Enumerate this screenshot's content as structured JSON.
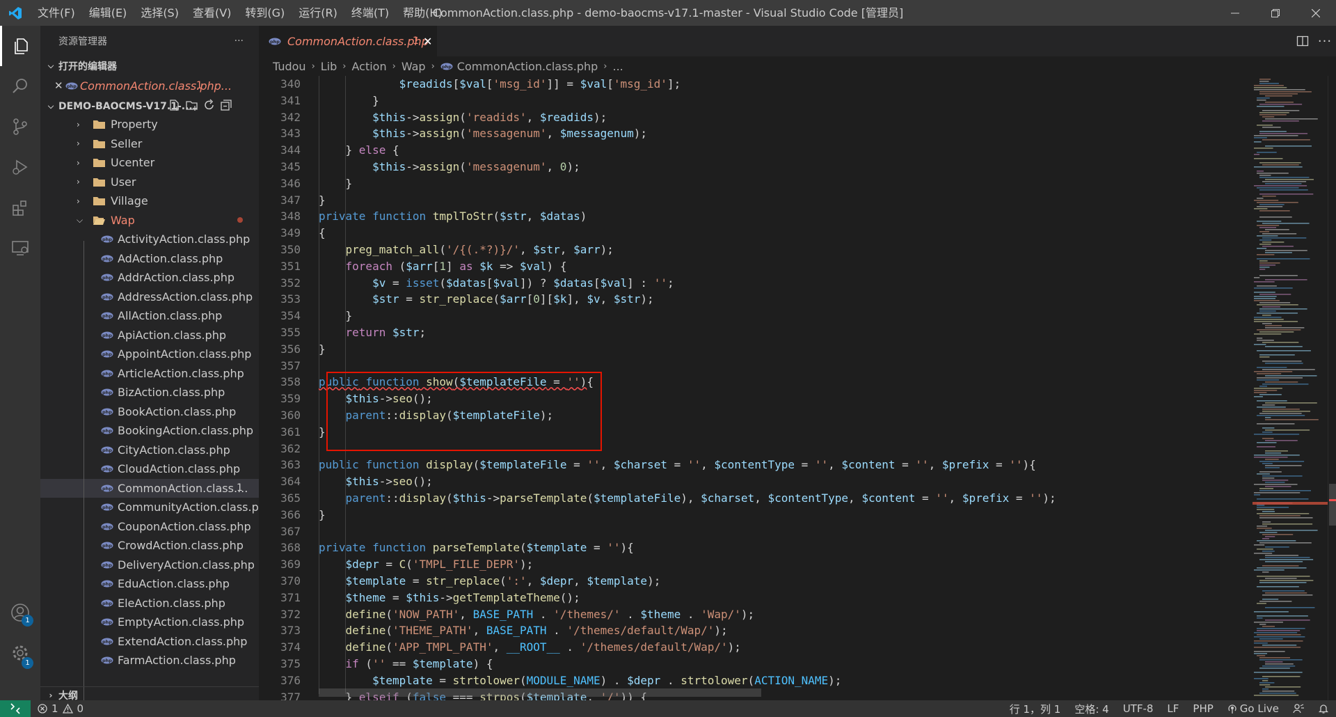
{
  "window": {
    "title": "CommonAction.class.php - demo-baocms-v17.1-master - Visual Studio Code [管理员]",
    "menu": [
      "文件(F)",
      "编辑(E)",
      "选择(S)",
      "查看(V)",
      "转到(G)",
      "运行(R)",
      "终端(T)",
      "帮助(H)"
    ]
  },
  "activity_bar": {
    "accounts_badge": "1",
    "settings_badge": "1"
  },
  "sidebar": {
    "title": "资源管理器",
    "more": "···",
    "open_editors_label": "打开的编辑器",
    "open_editor_file": "CommonAction.class.php...",
    "open_editor_problems": "1",
    "workspace_label": "DEMO-BAOCMS-V17.1-...",
    "folders": [
      "Property",
      "Seller",
      "Ucenter",
      "User",
      "Village"
    ],
    "open_folder": "Wap",
    "files": [
      "ActivityAction.class.php",
      "AdAction.class.php",
      "AddrAction.class.php",
      "AddressAction.class.php",
      "AllAction.class.php",
      "ApiAction.class.php",
      "AppointAction.class.php",
      "ArticleAction.class.php",
      "BizAction.class.php",
      "BookAction.class.php",
      "BookingAction.class.php",
      "CityAction.class.php",
      "CloudAction.class.php",
      "CommonAction.class....",
      "CommunityAction.class.php",
      "CouponAction.class.php",
      "CrowdAction.class.php",
      "DeliveryAction.class.php",
      "EduAction.class.php",
      "EleAction.class.php",
      "EmptyAction.class.php",
      "ExtendAction.class.php",
      "FarmAction.class.php"
    ],
    "selected_file_problems": "1",
    "outline_label": "大纲"
  },
  "tab": {
    "label": "CommonAction.class.php",
    "problems": "1",
    "close": "✕"
  },
  "breadcrumb": [
    "Tudou",
    "Lib",
    "Action",
    "Wap",
    "CommonAction.class.php",
    "..."
  ],
  "editor": {
    "line_numbers": [
      "340",
      "341",
      "342",
      "343",
      "344",
      "345",
      "346",
      "347",
      "348",
      "349",
      "350",
      "351",
      "352",
      "353",
      "354",
      "355",
      "356",
      "357",
      "358",
      "359",
      "360",
      "361",
      "362",
      "363",
      "364",
      "365",
      "366",
      "367",
      "368",
      "369",
      "370",
      "371",
      "372",
      "373",
      "374",
      "375",
      "376",
      "377"
    ]
  },
  "status": {
    "errors": "1",
    "warnings": "0",
    "position": "行 1，列 1",
    "spaces": "空格: 4",
    "encoding": "UTF-8",
    "eol": "LF",
    "language": "PHP",
    "golive": "Go Live"
  },
  "colors": {
    "accent": "#007acc",
    "error": "#f48771",
    "highlight_box": "#e51400"
  }
}
